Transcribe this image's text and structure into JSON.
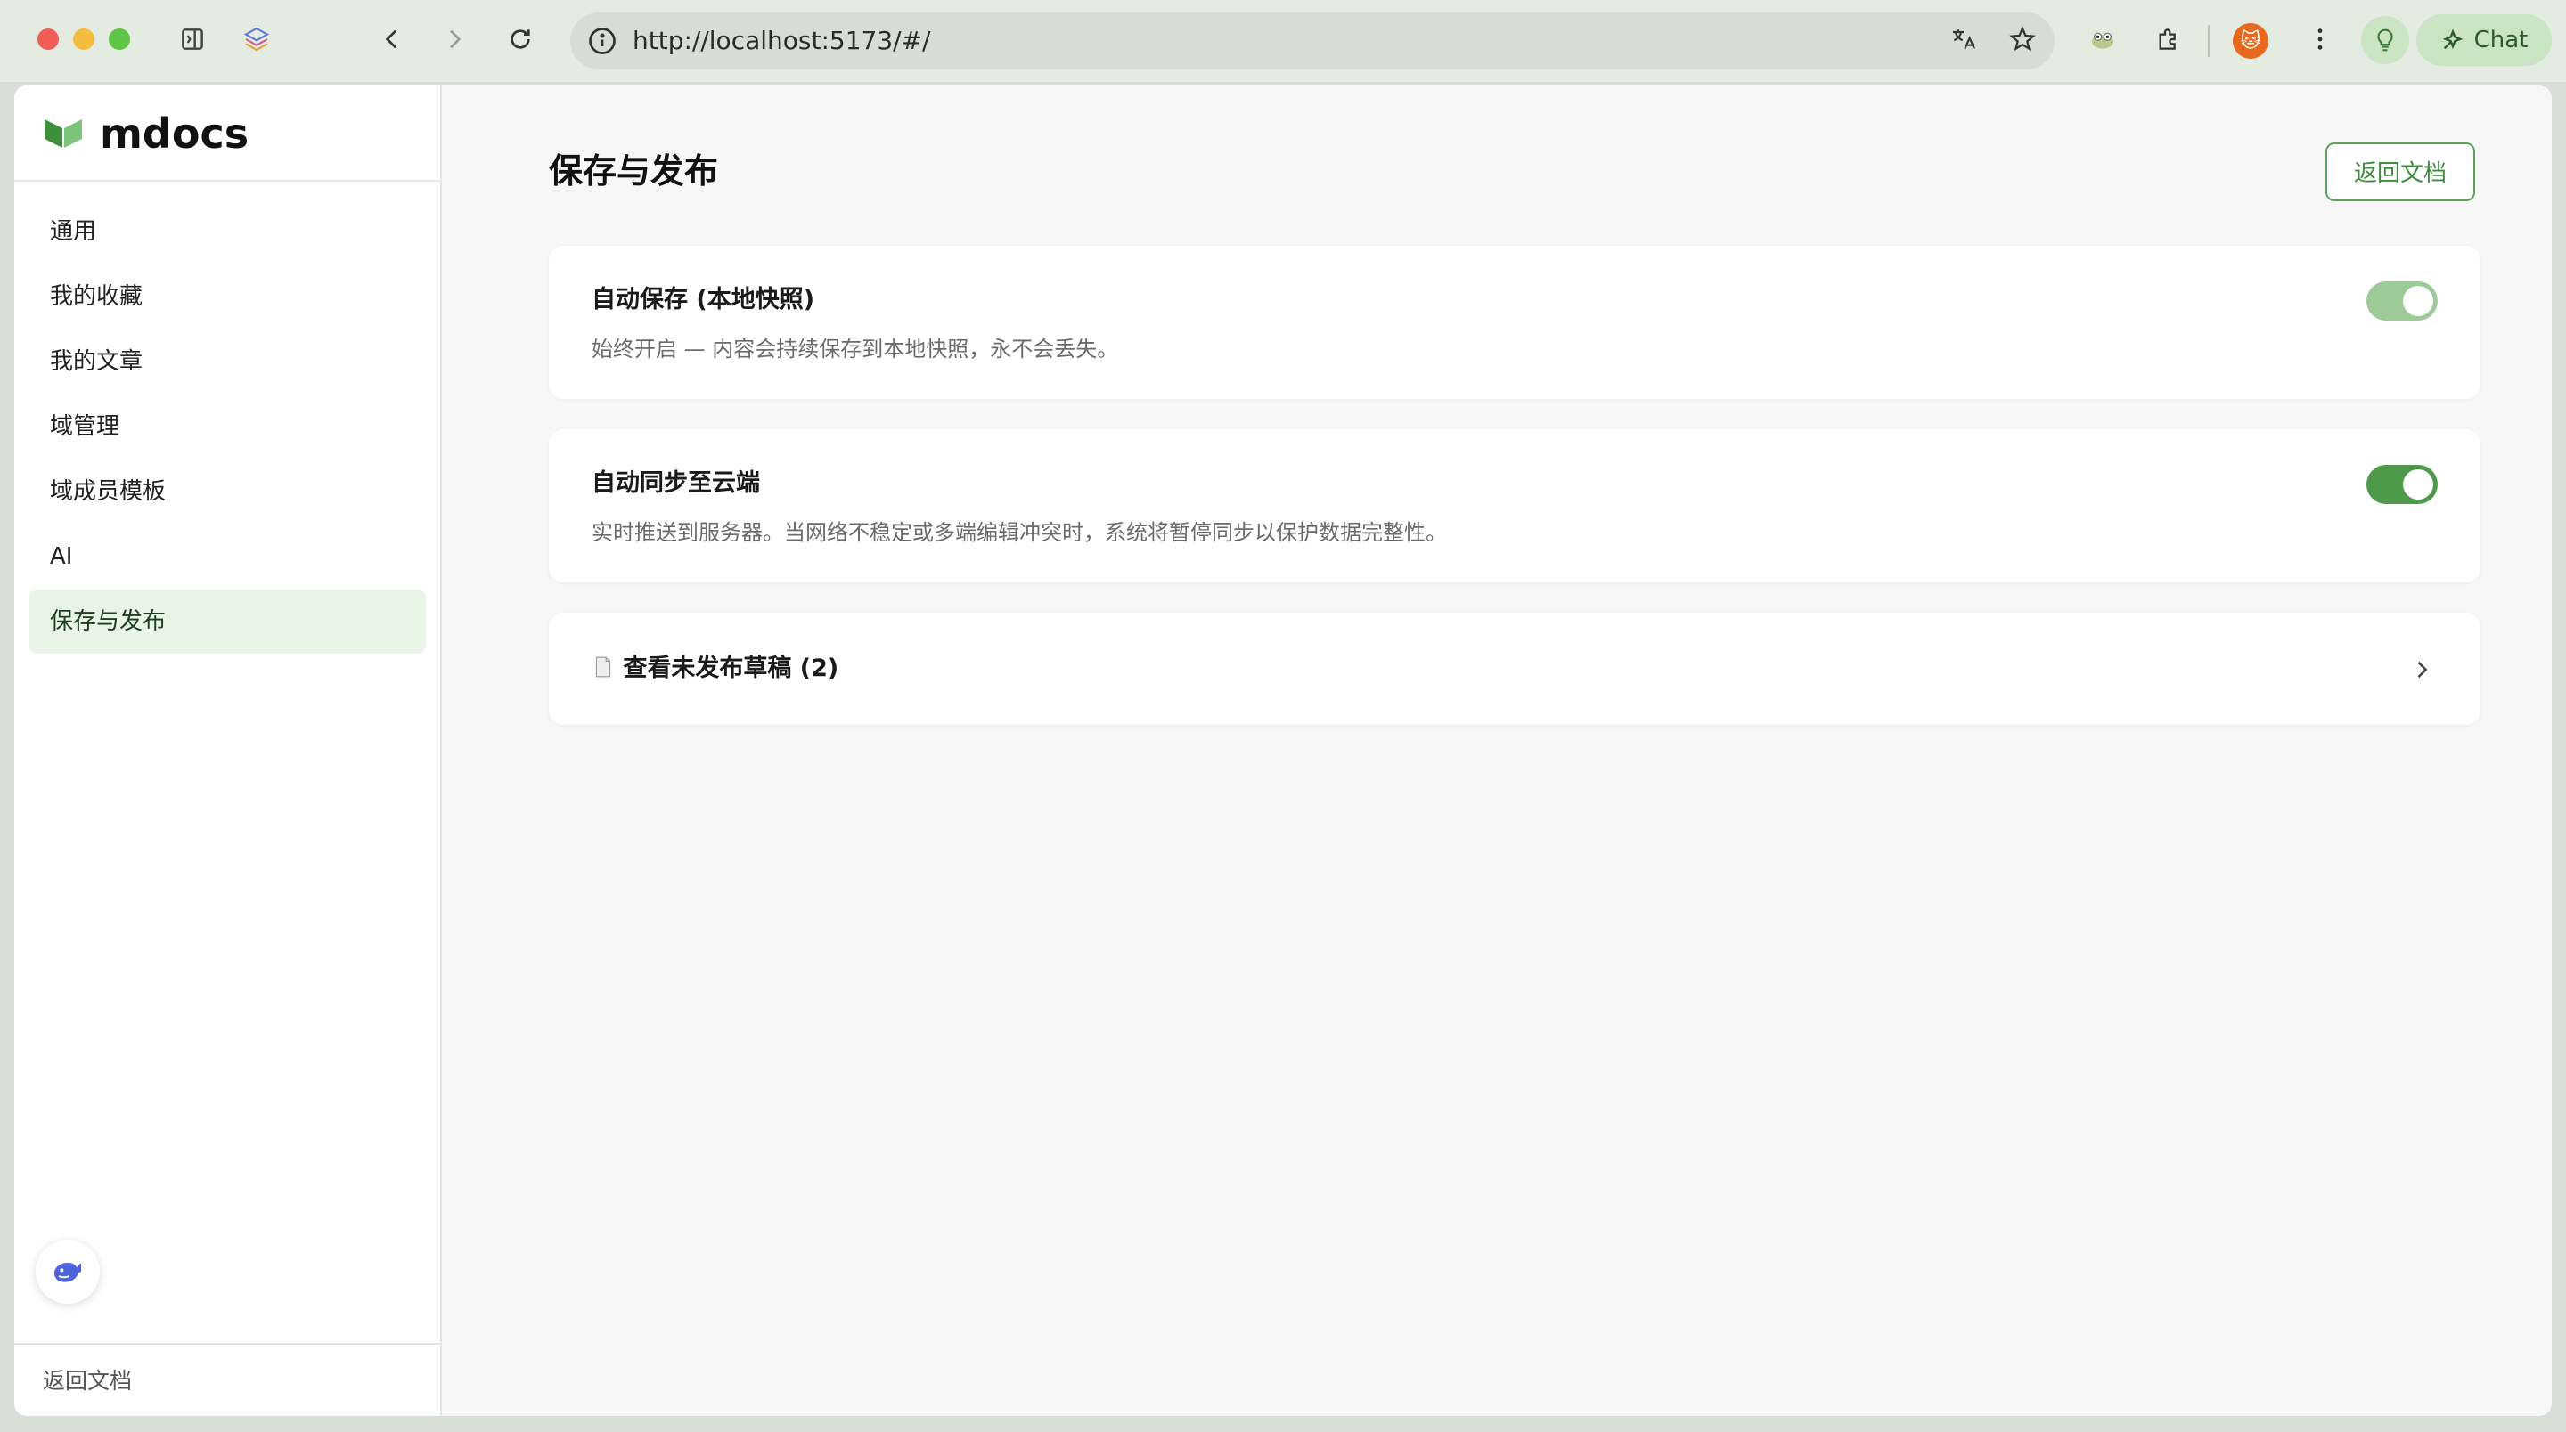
{
  "browser": {
    "url": "http://localhost:5173/#/",
    "chat_label": "Chat"
  },
  "sidebar": {
    "brand": "mdocs",
    "items": [
      {
        "label": "通用"
      },
      {
        "label": "我的收藏"
      },
      {
        "label": "我的文章"
      },
      {
        "label": "域管理"
      },
      {
        "label": "域成员模板"
      },
      {
        "label": "AI"
      },
      {
        "label": "保存与发布",
        "active": true
      }
    ],
    "footer_link": "返回文档"
  },
  "main": {
    "title": "保存与发布",
    "return_button": "返回文档",
    "autosave": {
      "title": "自动保存 (本地快照)",
      "description": "始终开启 — 内容会持续保存到本地快照，永不会丢失。",
      "enabled": true
    },
    "cloud_sync": {
      "title": "自动同步至云端",
      "description": "实时推送到服务器。当网络不稳定或多端编辑冲突时，系统将暂停同步以保护数据完整性。",
      "enabled": true
    },
    "drafts": {
      "icon": "document-icon",
      "label": "查看未发布草稿 (2)"
    }
  },
  "colors": {
    "accent": "#4d9a4b",
    "accent_light": "#e8f4e6",
    "toggle_dim": "#9dcb98"
  }
}
